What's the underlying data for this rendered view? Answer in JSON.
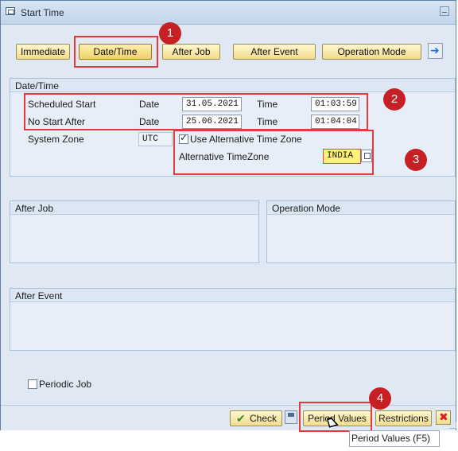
{
  "window": {
    "title": "Start Time"
  },
  "start_buttons": {
    "immediate": "Immediate",
    "date_time": "Date/Time",
    "after_job": "After Job",
    "after_event": "After Event",
    "operation_mode": "Operation Mode"
  },
  "datetime_section": {
    "title": "Date/Time",
    "scheduled_start_label": "Scheduled Start",
    "no_start_after_label": "No Start After",
    "date_label": "Date",
    "time_label": "Time",
    "scheduled_start_date": "31.05.2021",
    "scheduled_start_time": "01:03:59",
    "no_start_after_date": "25.06.2021",
    "no_start_after_time": "01:04:04",
    "system_zone_label": "System Zone",
    "system_zone_value": "UTC",
    "use_alt_timezone_label": "Use Alternative Time Zone",
    "alt_timezone_label": "Alternative TimeZone",
    "alt_timezone_value": "INDIA"
  },
  "sections": {
    "after_job": "After Job",
    "operation_mode": "Operation Mode",
    "after_event": "After Event"
  },
  "periodic_job": {
    "label": "Periodic Job"
  },
  "footer": {
    "check": "Check",
    "period_values": "Period Values",
    "restrictions": "Restrictions"
  },
  "tooltip": {
    "text": "Period Values    (F5)"
  },
  "markers": [
    "1",
    "2",
    "3",
    "4"
  ],
  "colors": {
    "button": "#f7e39d",
    "highlight": "#e33a3a",
    "marker": "#c62025",
    "window_bg": "#dfe8f3",
    "frame_header": "#dbe7f3"
  },
  "icons": {
    "window": "window-icon",
    "maximize": "maximize-icon",
    "next": "next-arrow-icon",
    "check": "check-icon",
    "save": "save-icon",
    "cancel": "cancel-icon",
    "help": "value-help-icon",
    "cursor": "mouse-pointer-icon"
  }
}
